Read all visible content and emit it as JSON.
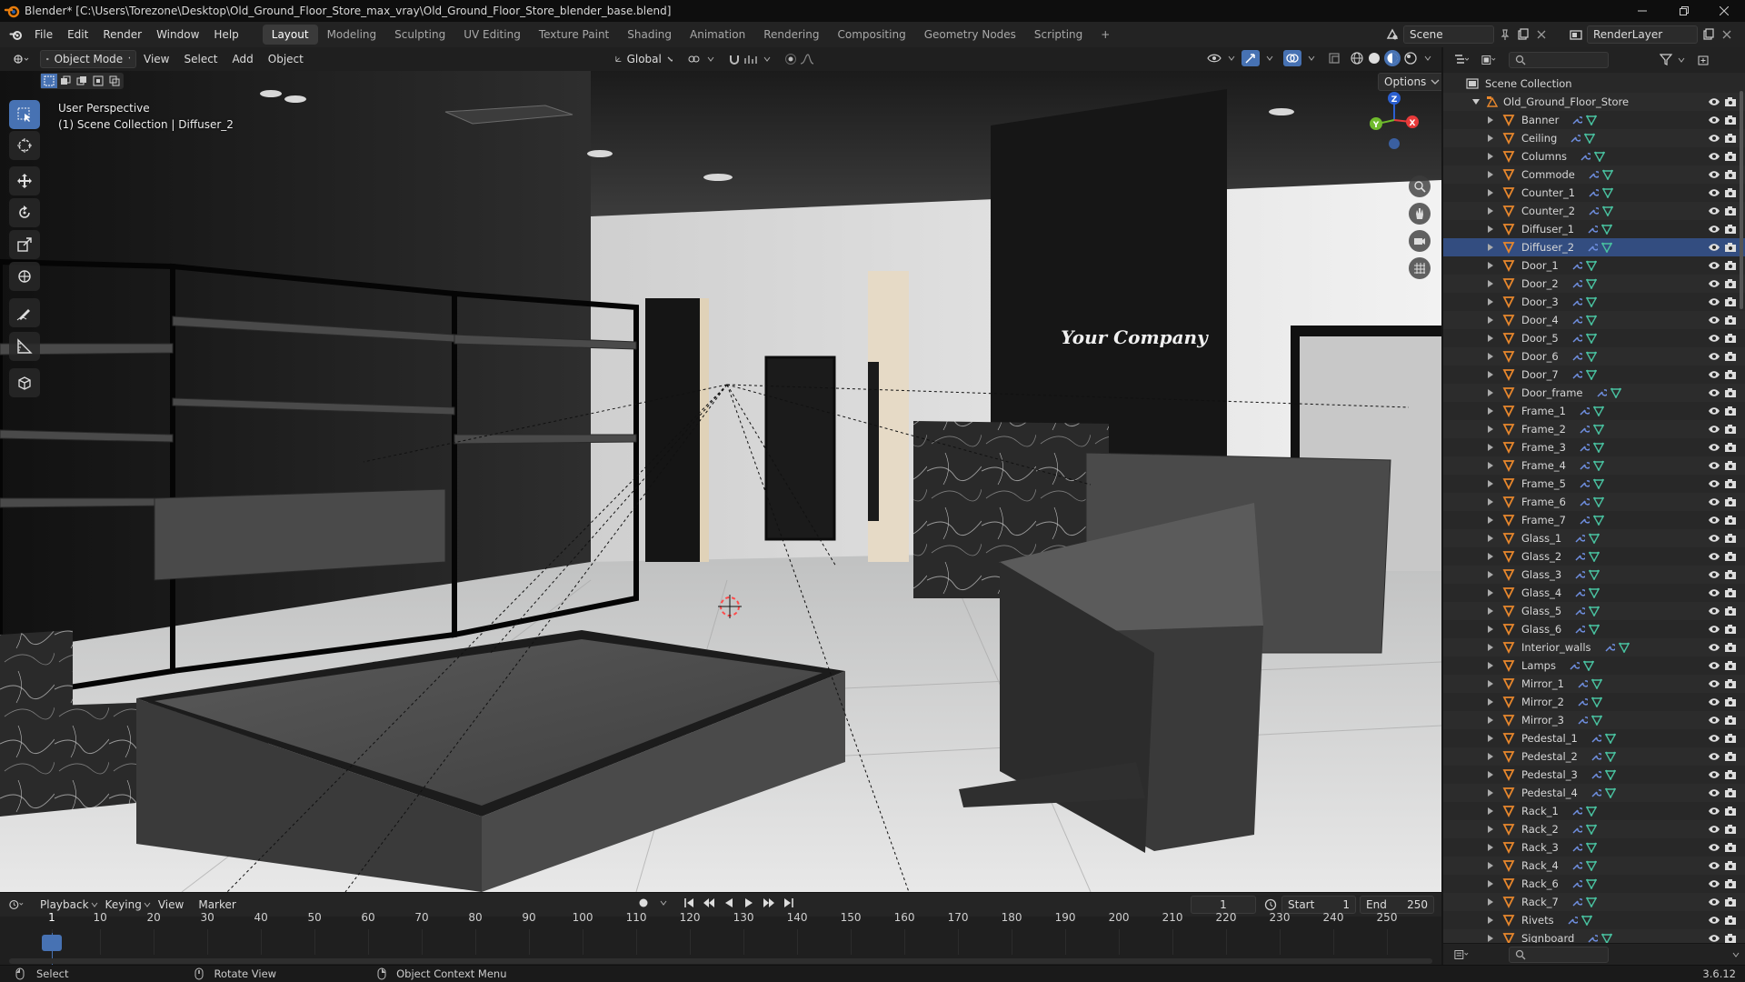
{
  "window": {
    "title": "Blender* [C:\\Users\\Torezone\\Desktop\\Old_Ground_Floor_Store_max_vray\\Old_Ground_Floor_Store_blender_base.blend]"
  },
  "menu": [
    "File",
    "Edit",
    "Render",
    "Window",
    "Help"
  ],
  "workspaces": [
    "Layout",
    "Modeling",
    "Sculpting",
    "UV Editing",
    "Texture Paint",
    "Shading",
    "Animation",
    "Rendering",
    "Compositing",
    "Geometry Nodes",
    "Scripting"
  ],
  "active_workspace": "Layout",
  "add_workspace": "+",
  "scene": {
    "name": "Scene",
    "view_layer": "RenderLayer"
  },
  "viewport_header": {
    "mode": "Object Mode",
    "menus": [
      "View",
      "Select",
      "Add",
      "Object"
    ],
    "transform_orientation": "Global",
    "options_label": "Options"
  },
  "viewport_overlay": {
    "perspective": "User Perspective",
    "context": "(1) Scene Collection | Diffuser_2",
    "sign_text": "Your Company"
  },
  "gizmo": {
    "z_label": "Z",
    "x_label": "X",
    "y_label": "Y"
  },
  "tools": [
    "select-box-icon",
    "cursor-icon",
    "move-icon",
    "rotate-icon",
    "scale-icon",
    "transform-icon",
    "annotate-icon",
    "measure-icon",
    "add-cube-icon"
  ],
  "outliner": {
    "root": "Scene Collection",
    "collection": "Old_Ground_Floor_Store",
    "selected": "Diffuser_2",
    "items": [
      "Banner",
      "Ceiling",
      "Columns",
      "Commode",
      "Counter_1",
      "Counter_2",
      "Diffuser_1",
      "Diffuser_2",
      "Door_1",
      "Door_2",
      "Door_3",
      "Door_4",
      "Door_5",
      "Door_6",
      "Door_7",
      "Door_frame",
      "Frame_1",
      "Frame_2",
      "Frame_3",
      "Frame_4",
      "Frame_5",
      "Frame_6",
      "Frame_7",
      "Glass_1",
      "Glass_2",
      "Glass_3",
      "Glass_4",
      "Glass_5",
      "Glass_6",
      "Interior_walls",
      "Lamps",
      "Mirror_1",
      "Mirror_2",
      "Mirror_3",
      "Pedestal_1",
      "Pedestal_2",
      "Pedestal_3",
      "Pedestal_4",
      "Rack_1",
      "Rack_2",
      "Rack_3",
      "Rack_4",
      "Rack_6",
      "Rack_7",
      "Rivets",
      "Signboard"
    ]
  },
  "timeline": {
    "menus": [
      "Playback",
      "Keying",
      "View",
      "Marker"
    ],
    "current_frame": "1",
    "start_label": "Start",
    "start": "1",
    "end_label": "End",
    "end": "250",
    "ticks": [
      "1",
      "10",
      "20",
      "30",
      "40",
      "50",
      "60",
      "70",
      "80",
      "90",
      "100",
      "110",
      "120",
      "130",
      "140",
      "150",
      "160",
      "170",
      "180",
      "190",
      "200",
      "210",
      "220",
      "230",
      "240",
      "250"
    ]
  },
  "statusbar": {
    "select": "Select",
    "rotate": "Rotate View",
    "context_menu": "Object Context Menu",
    "version": "3.6.12"
  },
  "colors": {
    "accent": "#4772b3",
    "selected_row": "#334d80",
    "object_icon": "#e8872c",
    "mesh_icon": "#49c2a0",
    "modifier_icon": "#6f8fe0"
  }
}
